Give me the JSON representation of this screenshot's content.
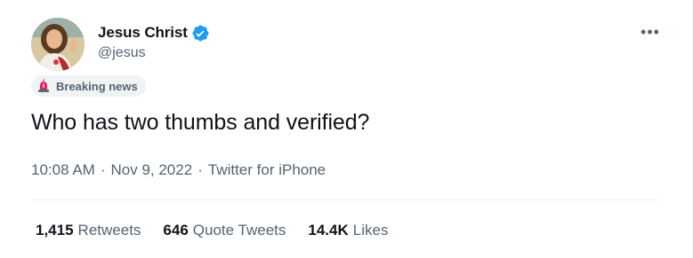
{
  "author": {
    "display_name": "Jesus Christ",
    "handle": "@jesus",
    "verified": true,
    "avatar_icon": "jesus-thumbs-up-avatar"
  },
  "menu": {
    "more_label": "•••"
  },
  "label_badge": {
    "icon": "siren-icon",
    "text": "Breaking news"
  },
  "tweet": {
    "text": "Who has two thumbs and verified?"
  },
  "meta": {
    "time": "10:08 AM",
    "separator": "·",
    "date": "Nov 9, 2022",
    "source": "Twitter for iPhone"
  },
  "stats": {
    "retweets_count": "1,415",
    "retweets_label": "Retweets",
    "quotes_count": "646",
    "quotes_label": "Quote Tweets",
    "likes_count": "14.4K",
    "likes_label": "Likes"
  },
  "colors": {
    "text_primary": "#0f1419",
    "text_secondary": "#536471",
    "verified_blue": "#1d9bf0",
    "badge_bg": "#eff3f4",
    "divider": "#eff3f4",
    "siren_red": "#e0245e"
  }
}
